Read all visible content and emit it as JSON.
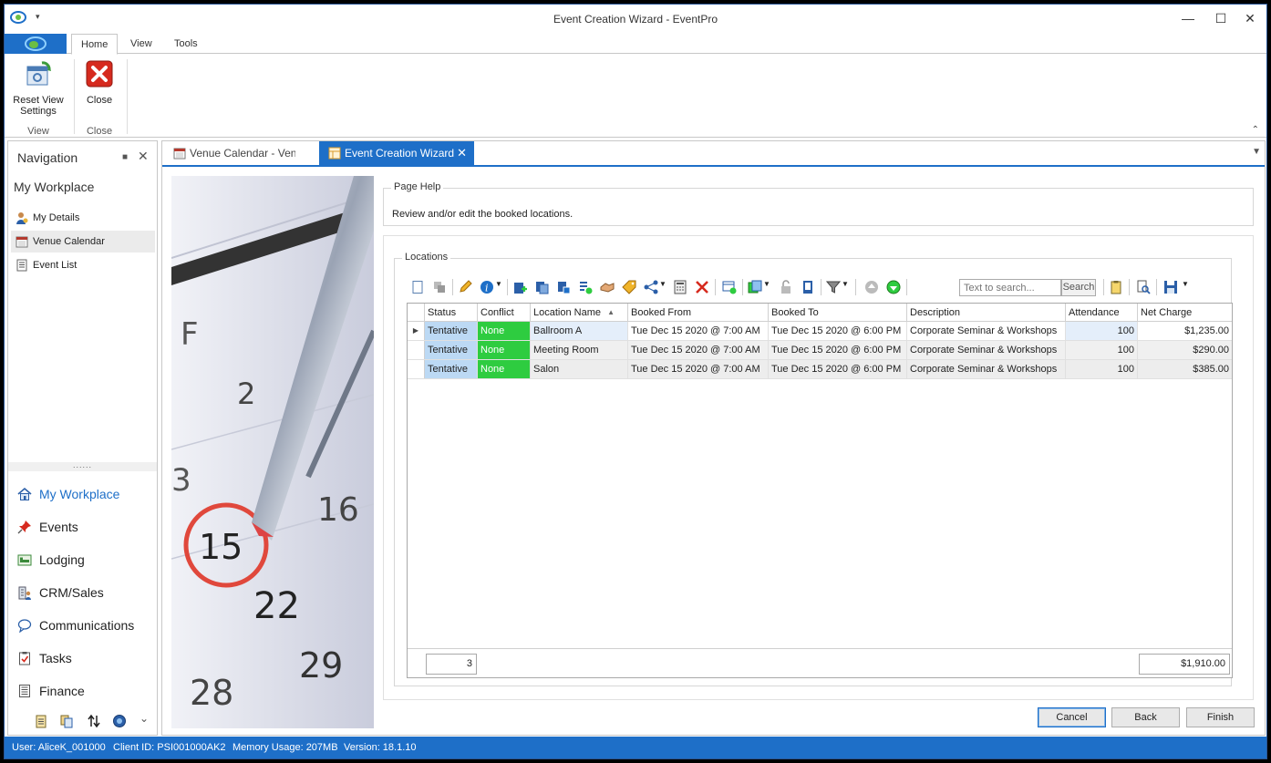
{
  "window": {
    "title": "Event Creation Wizard - EventPro",
    "minimize": "🗕",
    "maximize": "☐",
    "close": "✕"
  },
  "ribbon": {
    "tabs": [
      "Home",
      "View",
      "Tools"
    ],
    "reset_view_line1": "Reset View",
    "reset_view_line2": "Settings",
    "group_view": "View",
    "close_label": "Close",
    "group_close": "Close"
  },
  "nav": {
    "title": "Navigation",
    "section": "My Workplace",
    "items": [
      "My Details",
      "Venue Calendar",
      "Event List"
    ],
    "modules": [
      "My Workplace",
      "Events",
      "Lodging",
      "CRM/Sales",
      "Communications",
      "Tasks",
      "Finance"
    ],
    "splitter": "......"
  },
  "doc_tabs": [
    "Venue Calendar - Venue",
    "Event Creation Wizard"
  ],
  "page_help": {
    "legend": "Page Help",
    "text": "Review and/or edit the booked locations."
  },
  "locations": {
    "legend": "Locations",
    "search_placeholder": "Text to search...",
    "search_button": "Search",
    "columns": [
      "Status",
      "Conflict",
      "Location Name",
      "Booked From",
      "Booked To",
      "Description",
      "Attendance",
      "Net Charge"
    ],
    "rows": [
      {
        "status": "Tentative",
        "conflict": "None",
        "location": "Ballroom A",
        "from": "Tue Dec 15 2020 @ 7:00 AM",
        "to": "Tue Dec 15 2020 @ 6:00 PM",
        "description": "Corporate Seminar & Workshops",
        "attendance": "100",
        "charge": "$1,235.00"
      },
      {
        "status": "Tentative",
        "conflict": "None",
        "location": "Meeting Room",
        "from": "Tue Dec 15 2020 @ 7:00 AM",
        "to": "Tue Dec 15 2020 @ 6:00 PM",
        "description": "Corporate Seminar & Workshops",
        "attendance": "100",
        "charge": "$290.00"
      },
      {
        "status": "Tentative",
        "conflict": "None",
        "location": "Salon",
        "from": "Tue Dec 15 2020 @ 7:00 AM",
        "to": "Tue Dec 15 2020 @ 6:00 PM",
        "description": "Corporate Seminar & Workshops",
        "attendance": "100",
        "charge": "$385.00"
      }
    ],
    "count": "3",
    "total": "$1,910.00"
  },
  "buttons": {
    "cancel": "Cancel",
    "back": "Back",
    "finish": "Finish"
  },
  "status": {
    "user": "User: AliceK_001000",
    "client": "Client ID: PSI001000AK2",
    "memory": "Memory Usage: 207MB",
    "version": "Version: 18.1.10"
  },
  "colors": {
    "accent": "#1e6fc8",
    "status_cell": "#bcd9f4",
    "conflict_none": "#2ecc40"
  }
}
